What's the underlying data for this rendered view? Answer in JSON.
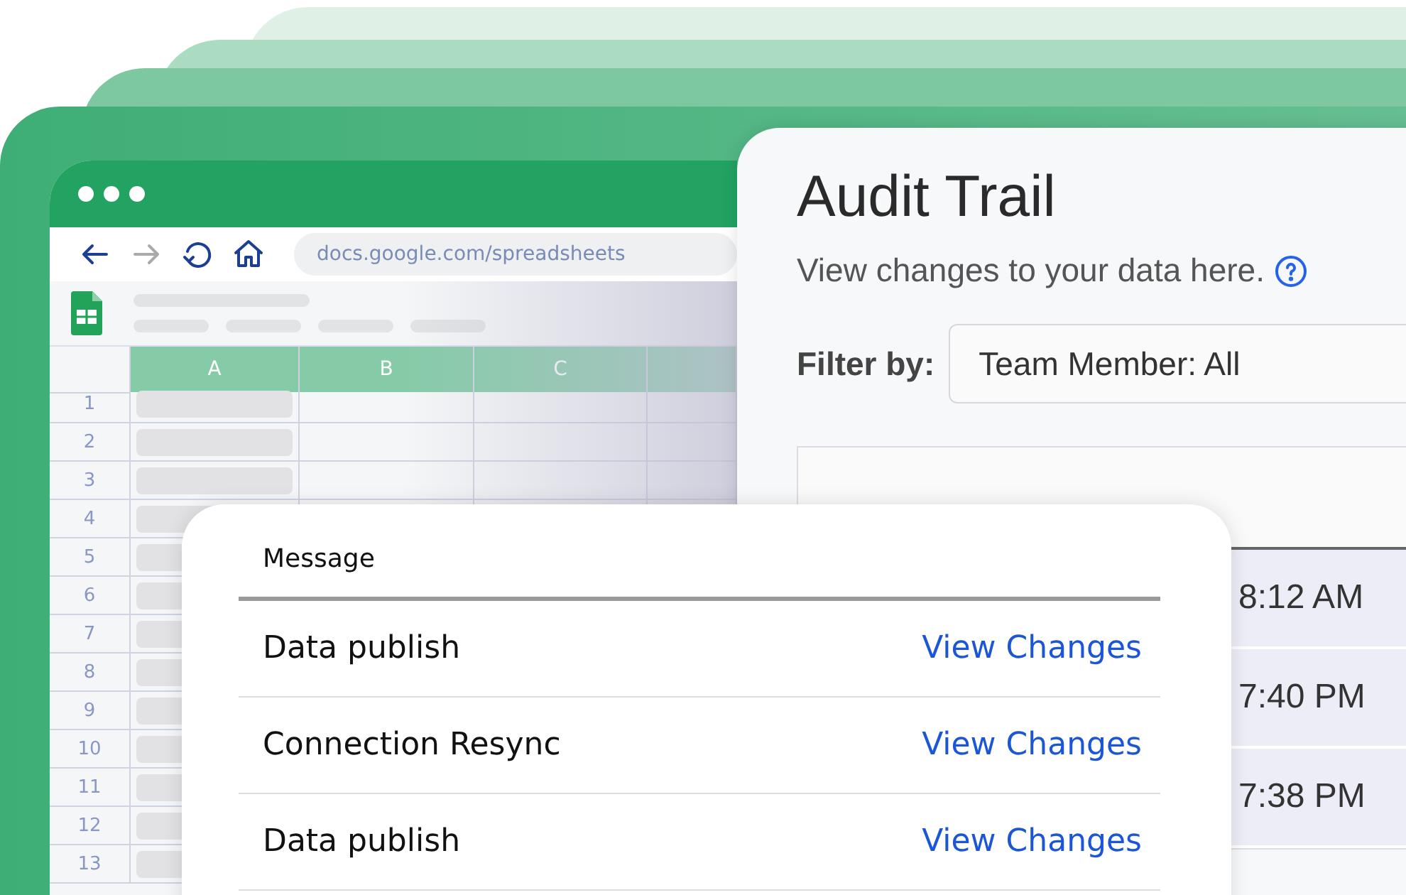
{
  "browser": {
    "url": "docs.google.com/spreadsheets",
    "columns": [
      "A",
      "B",
      "C"
    ],
    "rows": [
      "1",
      "2",
      "3",
      "4",
      "5",
      "6",
      "7",
      "8",
      "9",
      "10",
      "11",
      "12",
      "13"
    ]
  },
  "audit_trail": {
    "title": "Audit Trail",
    "subtitle": "View changes to your data here.",
    "filter_label": "Filter by:",
    "filter_value": "Team Member: All",
    "times": [
      "8:12 AM",
      "7:40 PM",
      "7:38 PM"
    ]
  },
  "messages": {
    "header": "Message",
    "rows": [
      {
        "message": "Data publish",
        "action": "View Changes"
      },
      {
        "message": "Connection Resync",
        "action": "View Changes"
      },
      {
        "message": "Data publish",
        "action": "View Changes"
      }
    ]
  }
}
